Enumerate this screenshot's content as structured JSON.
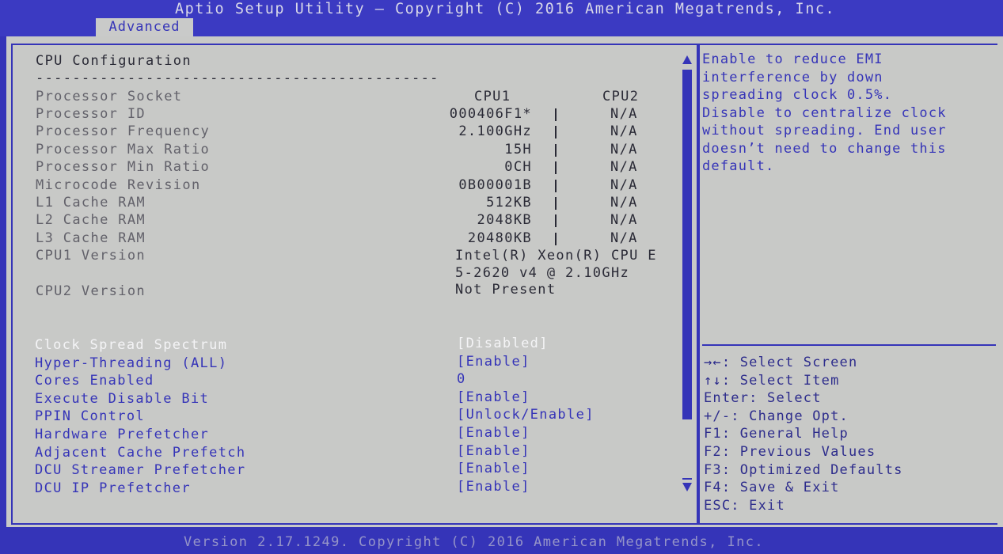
{
  "title": "Aptio Setup Utility – Copyright (C) 2016 American Megatrends, Inc.",
  "tab": "Advanced",
  "section_title": "CPU Configuration",
  "divider": "--------------------------------------------",
  "proc_headers": {
    "label": "Processor Socket",
    "cpu1": "CPU1",
    "cpu2": "CPU2"
  },
  "proc_rows": [
    {
      "label": "Processor ID",
      "cpu1": "000406F1*",
      "cpu2": "N/A"
    },
    {
      "label": "Processor Frequency",
      "cpu1": "2.100GHz",
      "cpu2": "N/A"
    },
    {
      "label": "Processor Max Ratio",
      "cpu1": "15H",
      "cpu2": "N/A"
    },
    {
      "label": "Processor Min Ratio",
      "cpu1": "0CH",
      "cpu2": "N/A"
    },
    {
      "label": "Microcode Revision",
      "cpu1": "0B00001B",
      "cpu2": "N/A"
    },
    {
      "label": "L1 Cache RAM",
      "cpu1": "512KB",
      "cpu2": "N/A"
    },
    {
      "label": "L2 Cache RAM",
      "cpu1": "2048KB",
      "cpu2": "N/A"
    },
    {
      "label": "L3 Cache RAM",
      "cpu1": "20480KB",
      "cpu2": "N/A"
    }
  ],
  "cpu1_version_label": "CPU1 Version",
  "cpu1_version_line1": "Intel(R) Xeon(R) CPU E",
  "cpu1_version_line2": "5-2620 v4 @ 2.10GHz",
  "cpu2_version_label": "CPU2 Version",
  "cpu2_version_value": "Not Present",
  "options": [
    {
      "label": "Clock Spread Spectrum",
      "value": "[Disabled]",
      "selected": true
    },
    {
      "label": "Hyper-Threading (ALL)",
      "value": "[Enable]"
    },
    {
      "label": "Cores Enabled",
      "value": "0"
    },
    {
      "label": "Execute Disable Bit",
      "value": "[Enable]"
    },
    {
      "label": "PPIN Control",
      "value": "[Unlock/Enable]"
    },
    {
      "label": "Hardware Prefetcher",
      "value": "[Enable]"
    },
    {
      "label": "Adjacent Cache Prefetch",
      "value": "[Enable]"
    },
    {
      "label": "DCU Streamer Prefetcher",
      "value": "[Enable]"
    },
    {
      "label": "DCU IP Prefetcher",
      "value": "[Enable]"
    }
  ],
  "help_text": [
    "Enable to reduce EMI",
    "interference by down",
    "spreading clock 0.5%.",
    "Disable to centralize clock",
    "without spreading. End user",
    "doesn’t need to change this",
    "default."
  ],
  "key_help": [
    "→←: Select Screen",
    "↑↓: Select Item",
    "Enter: Select",
    "+/-: Change Opt.",
    "F1: General Help",
    "F2: Previous Values",
    "F3: Optimized Defaults",
    "F4: Save & Exit",
    "ESC: Exit"
  ],
  "footer": "Version 2.17.1249. Copyright (C) 2016 American Megatrends, Inc.",
  "colors": {
    "bios_blue": "#3534b8",
    "panel_gray": "#c8c9c7",
    "highlight_white": "#f4f4f6"
  }
}
